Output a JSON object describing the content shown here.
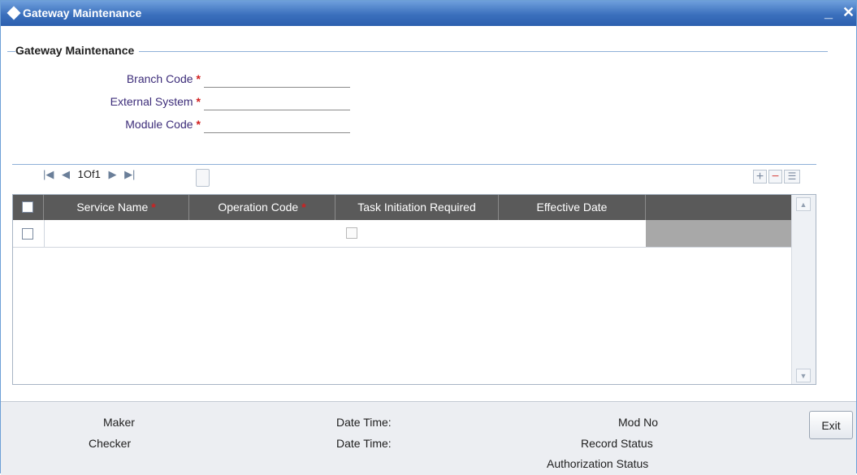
{
  "window": {
    "title": "Gateway Maintenance",
    "minimize": "_",
    "close": "✕"
  },
  "section": {
    "legend": "Gateway Maintenance"
  },
  "fields": [
    {
      "label": "Branch Code",
      "required": "*",
      "value": ""
    },
    {
      "label": "External System",
      "required": "*",
      "value": ""
    },
    {
      "label": "Module Code",
      "required": "*",
      "value": ""
    }
  ],
  "pager": {
    "first": "|◀",
    "prev": "◀",
    "page_text": "1Of1",
    "next": "▶",
    "last": "▶|"
  },
  "toolbar": {
    "add": "+",
    "delete": "−",
    "list": "☰"
  },
  "table": {
    "columns": [
      {
        "label": "Service Name",
        "required": "*"
      },
      {
        "label": "Operation Code",
        "required": "*"
      },
      {
        "label": "Task Initiation Required",
        "required": ""
      },
      {
        "label": "Effective Date",
        "required": ""
      }
    ],
    "rows": [
      {
        "service_name": "",
        "operation_code": "",
        "task_initiation_required": false,
        "effective_date": ""
      }
    ]
  },
  "footer": {
    "maker": "Maker",
    "checker": "Checker",
    "date_time_1": "Date Time:",
    "date_time_2": "Date Time:",
    "mod_no": "Mod No",
    "record_status": "Record Status",
    "authorization_status": "Authorization Status",
    "exit": "Exit"
  },
  "colors": {
    "titlebar": "#3b70bd",
    "header_bg": "#5a5a5a",
    "required": "#d11f1f",
    "label": "#3d2d7a"
  }
}
